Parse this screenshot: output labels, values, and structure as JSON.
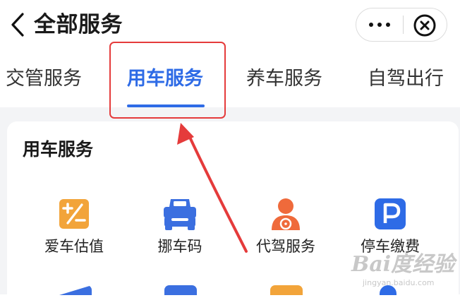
{
  "header": {
    "title": "全部服务"
  },
  "capsule": {
    "more_icon": "more-dots-icon",
    "close_icon": "circle-close-icon"
  },
  "tabs": [
    {
      "label": "交管服务",
      "active": false
    },
    {
      "label": "用车服务",
      "active": true
    },
    {
      "label": "养车服务",
      "active": false
    },
    {
      "label": "自驾出行",
      "active": false
    }
  ],
  "section": {
    "title": "用车服务",
    "items": [
      {
        "label": "爱车估值",
        "icon": "valuation-icon",
        "color": "#f2a43a"
      },
      {
        "label": "挪车码",
        "icon": "car-move-code-icon",
        "color": "#3b6fe0"
      },
      {
        "label": "代驾服务",
        "icon": "driver-icon",
        "color": "#ef6a3b"
      },
      {
        "label": "停车缴费",
        "icon": "parking-icon",
        "color": "#2e6be6"
      }
    ]
  },
  "watermark": {
    "brand": "Bai度经验",
    "url": "jingyan.baidu.com"
  },
  "colors": {
    "accent": "#2e6be6",
    "highlight": "#e53b3b",
    "background": "#f3f4f6"
  }
}
